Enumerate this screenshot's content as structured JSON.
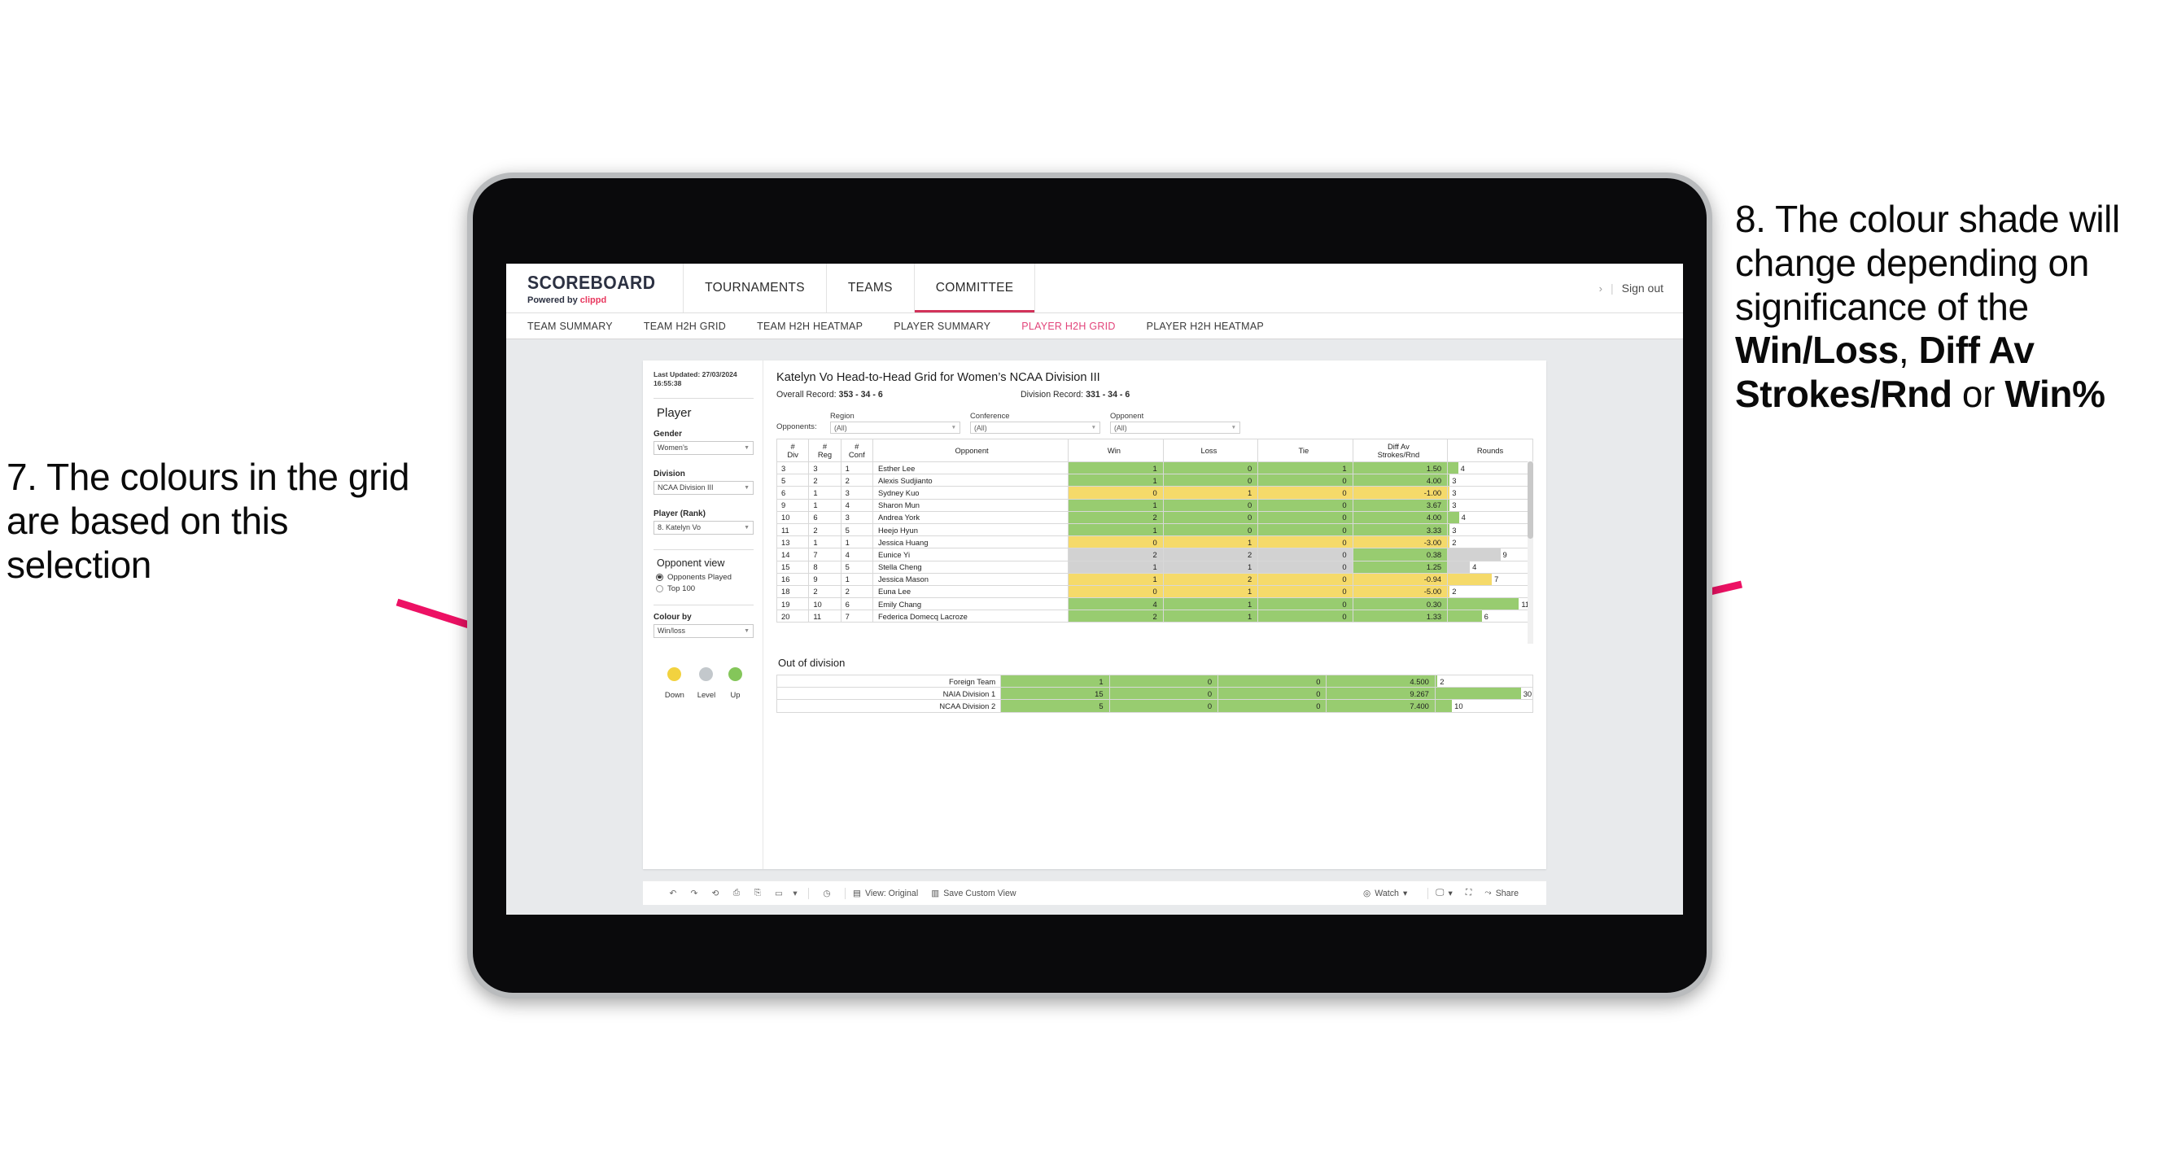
{
  "annotations": {
    "left": {
      "id": "7",
      "text": "7. The colours in the grid are based on this selection"
    },
    "right": {
      "id": "8",
      "parts": [
        {
          "text": "8. The colour shade will change depending on significance of the ",
          "bold": false
        },
        {
          "text": "Win/Loss",
          "bold": true
        },
        {
          "text": ", ",
          "bold": false
        },
        {
          "text": "Diff Av Strokes/Rnd",
          "bold": true
        },
        {
          "text": " or ",
          "bold": false
        },
        {
          "text": "Win%",
          "bold": true
        }
      ]
    },
    "arrow_color": "#ed1164"
  },
  "header": {
    "brand_name": "SCOREBOARD",
    "brand_sub_prefix": "Powered by ",
    "brand_sub_accent": "clippd",
    "accent_color": "#e8365d",
    "nav": [
      {
        "label": "TOURNAMENTS",
        "active": false
      },
      {
        "label": "TEAMS",
        "active": false
      },
      {
        "label": "COMMITTEE",
        "active": true
      }
    ],
    "chevron": "›",
    "divider": "|",
    "sign_out": "Sign out"
  },
  "subnav": [
    {
      "label": "TEAM SUMMARY",
      "active": false
    },
    {
      "label": "TEAM H2H GRID",
      "active": false
    },
    {
      "label": "TEAM H2H HEATMAP",
      "active": false
    },
    {
      "label": "PLAYER SUMMARY",
      "active": false
    },
    {
      "label": "PLAYER H2H GRID",
      "active": true
    },
    {
      "label": "PLAYER H2H HEATMAP",
      "active": false
    }
  ],
  "sidebar": {
    "last_updated": "Last Updated: 27/03/2024 16:55:38",
    "section_player": "Player",
    "gender": {
      "label": "Gender",
      "value": "Women’s"
    },
    "division": {
      "label": "Division",
      "value": "NCAA Division III"
    },
    "player_rank": {
      "label": "Player (Rank)",
      "value": "8. Katelyn Vo"
    },
    "opponent_view": {
      "label": "Opponent view",
      "options": [
        {
          "label": "Opponents Played",
          "selected": true
        },
        {
          "label": "Top 100",
          "selected": false
        }
      ]
    },
    "colour_by": {
      "label": "Colour by",
      "value": "Win/loss"
    },
    "legend": [
      {
        "label": "Down",
        "color": "#f2d23f"
      },
      {
        "label": "Level",
        "color": "#c3c8cc"
      },
      {
        "label": "Up",
        "color": "#84c65a"
      }
    ]
  },
  "view": {
    "title": "Katelyn Vo Head-to-Head Grid for Women’s NCAA Division III",
    "overall_record_label": "Overall Record:",
    "overall_record_value": "353 -  34 - 6",
    "division_record_label": "Division Record:",
    "division_record_value": "331 -  34 - 6",
    "opponents_label": "Opponents:",
    "filters": [
      {
        "caption": "Region",
        "value": "(All)"
      },
      {
        "caption": "Conference",
        "value": "(All)"
      },
      {
        "caption": "Opponent",
        "value": "(All)"
      }
    ],
    "out_of_division_label": "Out of division"
  },
  "chart_data": {
    "type": "table",
    "title": "Katelyn Vo Head-to-Head Grid for Women’s NCAA Division III",
    "columns": [
      "# Div",
      "# Reg",
      "# Conf",
      "Opponent",
      "Win",
      "Loss",
      "Tie",
      "Diff Av Strokes/Rnd",
      "Rounds"
    ],
    "column_headers_two_line": [
      {
        "l1": "#",
        "l2": "Div"
      },
      {
        "l1": "#",
        "l2": "Reg"
      },
      {
        "l1": "#",
        "l2": "Conf"
      },
      {
        "l1": "Opponent",
        "l2": ""
      },
      {
        "l1": "Win",
        "l2": ""
      },
      {
        "l1": "Loss",
        "l2": ""
      },
      {
        "l1": "Tie",
        "l2": ""
      },
      {
        "l1": "Diff Av",
        "l2": "Strokes/Rnd"
      },
      {
        "l1": "Rounds",
        "l2": ""
      }
    ],
    "colors": {
      "up": "#98cc70",
      "down": "#f5da6a",
      "level": "#d2d2d2",
      "none": "#ffffff"
    },
    "rows": [
      {
        "div": "3",
        "reg": "3",
        "conf": "1",
        "opponent": "Esther Lee",
        "win": "1",
        "loss": "0",
        "tie": "1",
        "diff": "1.50",
        "rounds": "4",
        "shade": "up",
        "rounds_bar": 0.12
      },
      {
        "div": "5",
        "reg": "2",
        "conf": "2",
        "opponent": "Alexis Sudjianto",
        "win": "1",
        "loss": "0",
        "tie": "0",
        "diff": "4.00",
        "rounds": "3",
        "shade": "up",
        "rounds_bar": 0.02
      },
      {
        "div": "6",
        "reg": "1",
        "conf": "3",
        "opponent": "Sydney Kuo",
        "win": "0",
        "loss": "1",
        "tie": "0",
        "diff": "-1.00",
        "rounds": "3",
        "shade": "down",
        "rounds_bar": 0.02
      },
      {
        "div": "9",
        "reg": "1",
        "conf": "4",
        "opponent": "Sharon Mun",
        "win": "1",
        "loss": "0",
        "tie": "0",
        "diff": "3.67",
        "rounds": "3",
        "shade": "up",
        "rounds_bar": 0.02
      },
      {
        "div": "10",
        "reg": "6",
        "conf": "3",
        "opponent": "Andrea York",
        "win": "2",
        "loss": "0",
        "tie": "0",
        "diff": "4.00",
        "rounds": "4",
        "shade": "up",
        "rounds_bar": 0.13
      },
      {
        "div": "11",
        "reg": "2",
        "conf": "5",
        "opponent": "Heejo Hyun",
        "win": "1",
        "loss": "0",
        "tie": "0",
        "diff": "3.33",
        "rounds": "3",
        "shade": "up",
        "rounds_bar": 0.02
      },
      {
        "div": "13",
        "reg": "1",
        "conf": "1",
        "opponent": "Jessica Huang",
        "win": "0",
        "loss": "1",
        "tie": "0",
        "diff": "-3.00",
        "rounds": "2",
        "shade": "down",
        "rounds_bar": 0.02
      },
      {
        "div": "14",
        "reg": "7",
        "conf": "4",
        "opponent": "Eunice Yi",
        "win": "2",
        "loss": "2",
        "tie": "0",
        "diff": "0.38",
        "rounds": "9",
        "shade": "level",
        "diff_shade": "up",
        "rounds_bar": 0.62
      },
      {
        "div": "15",
        "reg": "8",
        "conf": "5",
        "opponent": "Stella Cheng",
        "win": "1",
        "loss": "1",
        "tie": "0",
        "diff": "1.25",
        "rounds": "4",
        "shade": "level",
        "diff_shade": "up",
        "rounds_bar": 0.26
      },
      {
        "div": "16",
        "reg": "9",
        "conf": "1",
        "opponent": "Jessica Mason",
        "win": "1",
        "loss": "2",
        "tie": "0",
        "diff": "-0.94",
        "rounds": "7",
        "shade": "down",
        "rounds_bar": 0.52
      },
      {
        "div": "18",
        "reg": "2",
        "conf": "2",
        "opponent": "Euna Lee",
        "win": "0",
        "loss": "1",
        "tie": "0",
        "diff": "-5.00",
        "rounds": "2",
        "shade": "down",
        "rounds_bar": 0.02
      },
      {
        "div": "19",
        "reg": "10",
        "conf": "6",
        "opponent": "Emily Chang",
        "win": "4",
        "loss": "1",
        "tie": "0",
        "diff": "0.30",
        "rounds": "11",
        "shade": "up",
        "rounds_bar": 0.84
      },
      {
        "div": "20",
        "reg": "11",
        "conf": "7",
        "opponent": "Federica Domecq Lacroze",
        "win": "2",
        "loss": "1",
        "tie": "0",
        "diff": "1.33",
        "rounds": "6",
        "shade": "up",
        "rounds_bar": 0.4
      }
    ],
    "out_of_division": [
      {
        "opponent": "Foreign Team",
        "win": "1",
        "loss": "0",
        "tie": "0",
        "diff": "4.500",
        "rounds": "2",
        "shade": "up",
        "rounds_bar": 0.02
      },
      {
        "opponent": "NAIA Division 1",
        "win": "15",
        "loss": "0",
        "tie": "0",
        "diff": "9.267",
        "rounds": "30",
        "shade": "up",
        "rounds_bar": 0.88
      },
      {
        "opponent": "NCAA Division 2",
        "win": "5",
        "loss": "0",
        "tie": "0",
        "diff": "7.400",
        "rounds": "10",
        "shade": "up",
        "rounds_bar": 0.17
      }
    ]
  },
  "toolbar": {
    "view_original": "View: Original",
    "save_custom_view": "Save Custom View",
    "watch": "Watch",
    "share": "Share",
    "caret": "▾"
  }
}
